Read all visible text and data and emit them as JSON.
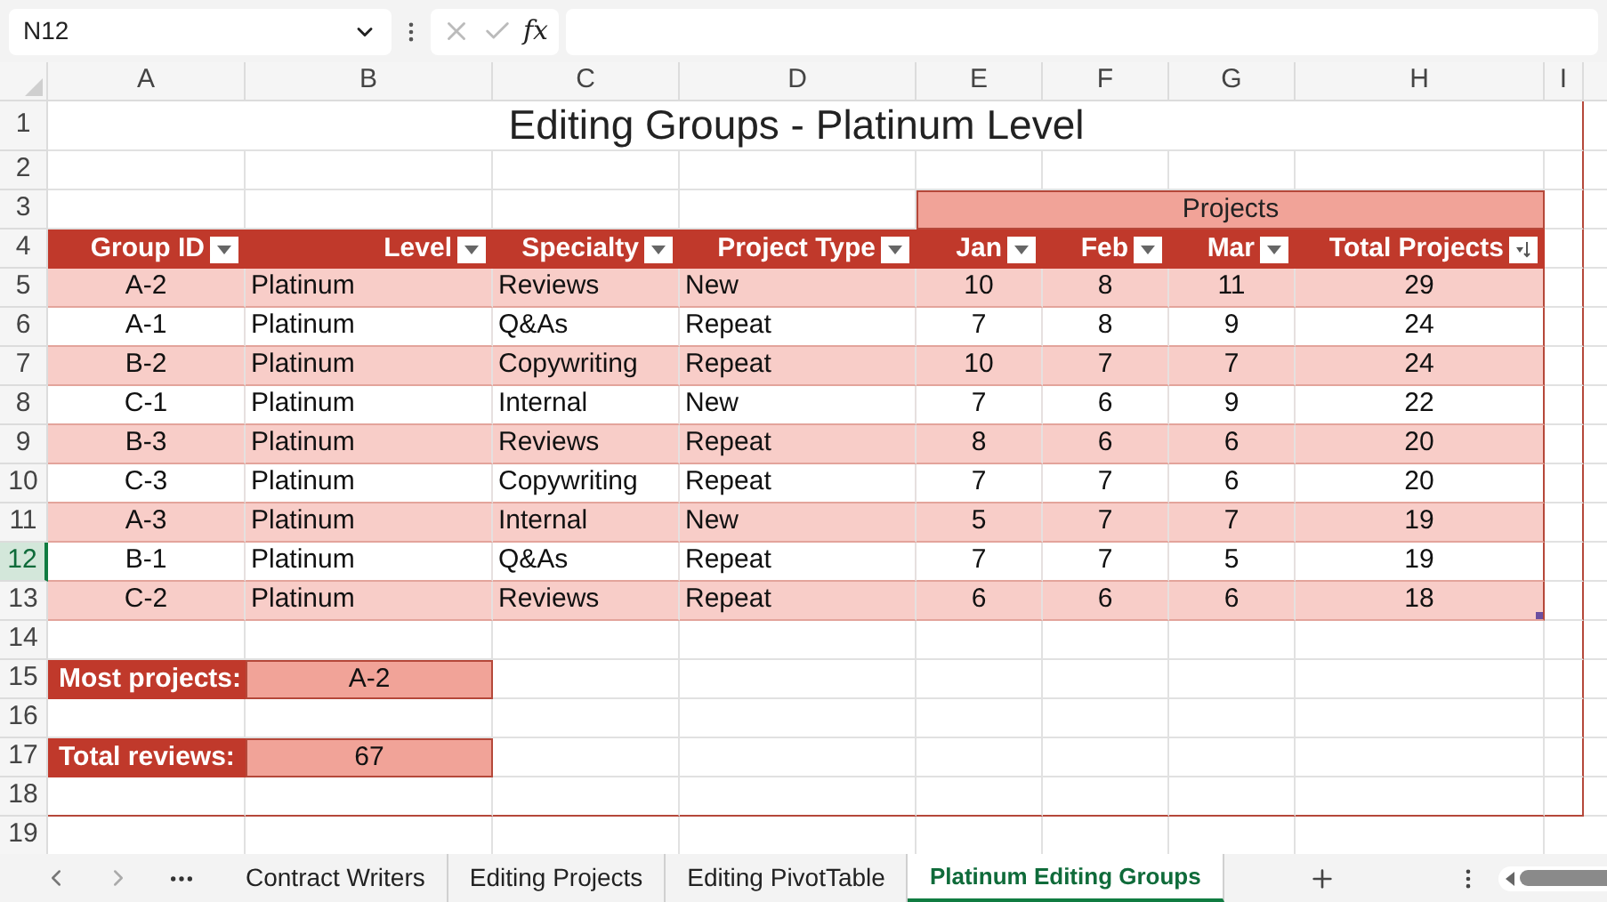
{
  "name_box": "N12",
  "formula_icon": "fx",
  "column_headers": [
    {
      "label": "A",
      "selected": false
    },
    {
      "label": "B",
      "selected": false
    },
    {
      "label": "C",
      "selected": false
    },
    {
      "label": "D",
      "selected": false
    },
    {
      "label": "E",
      "selected": false
    },
    {
      "label": "F",
      "selected": false
    },
    {
      "label": "G",
      "selected": false
    },
    {
      "label": "H",
      "selected": false
    },
    {
      "label": "I",
      "selected": false
    }
  ],
  "row_headers": [
    {
      "label": "1",
      "selected": false
    },
    {
      "label": "2",
      "selected": false
    },
    {
      "label": "3",
      "selected": false
    },
    {
      "label": "4",
      "selected": false
    },
    {
      "label": "5",
      "selected": false
    },
    {
      "label": "6",
      "selected": false
    },
    {
      "label": "7",
      "selected": false
    },
    {
      "label": "8",
      "selected": false
    },
    {
      "label": "9",
      "selected": false
    },
    {
      "label": "10",
      "selected": false
    },
    {
      "label": "11",
      "selected": false
    },
    {
      "label": "12",
      "selected": true
    },
    {
      "label": "13",
      "selected": false
    },
    {
      "label": "14",
      "selected": false
    },
    {
      "label": "15",
      "selected": false
    },
    {
      "label": "16",
      "selected": false
    },
    {
      "label": "17",
      "selected": false
    },
    {
      "label": "18",
      "selected": false
    },
    {
      "label": "19",
      "selected": false
    }
  ],
  "title": "Editing Groups - Platinum Level",
  "group_header": "Projects",
  "table": {
    "columns": [
      {
        "label": "Group ID",
        "kind": "filter"
      },
      {
        "label": "Level",
        "kind": "filter"
      },
      {
        "label": "Specialty",
        "kind": "filter"
      },
      {
        "label": "Project Type",
        "kind": "filter"
      },
      {
        "label": "Jan",
        "kind": "filter"
      },
      {
        "label": "Feb",
        "kind": "filter"
      },
      {
        "label": "Mar",
        "kind": "filter"
      },
      {
        "label": "Total Projects",
        "kind": "sorted"
      }
    ],
    "rows": [
      [
        "A-2",
        "Platinum",
        "Reviews",
        "New",
        "10",
        "8",
        "11",
        "29"
      ],
      [
        "A-1",
        "Platinum",
        "Q&As",
        "Repeat",
        "7",
        "8",
        "9",
        "24"
      ],
      [
        "B-2",
        "Platinum",
        "Copywriting",
        "Repeat",
        "10",
        "7",
        "7",
        "24"
      ],
      [
        "C-1",
        "Platinum",
        "Internal",
        "New",
        "7",
        "6",
        "9",
        "22"
      ],
      [
        "B-3",
        "Platinum",
        "Reviews",
        "Repeat",
        "8",
        "6",
        "6",
        "20"
      ],
      [
        "C-3",
        "Platinum",
        "Copywriting",
        "Repeat",
        "7",
        "7",
        "6",
        "20"
      ],
      [
        "A-3",
        "Platinum",
        "Internal",
        "New",
        "5",
        "7",
        "7",
        "19"
      ],
      [
        "B-1",
        "Platinum",
        "Q&As",
        "Repeat",
        "7",
        "7",
        "5",
        "19"
      ],
      [
        "C-2",
        "Platinum",
        "Reviews",
        "Repeat",
        "6",
        "6",
        "6",
        "18"
      ]
    ]
  },
  "summary": [
    {
      "label": "Most projects:",
      "value": "A-2"
    },
    {
      "label": "Total reviews:",
      "value": "67"
    }
  ],
  "sheet_tabs": [
    {
      "label": "Contract Writers",
      "selected": false
    },
    {
      "label": "Editing Projects",
      "selected": false
    },
    {
      "label": "Editing PivotTable",
      "selected": false
    },
    {
      "label": "Platinum Editing Groups",
      "selected": true
    }
  ]
}
